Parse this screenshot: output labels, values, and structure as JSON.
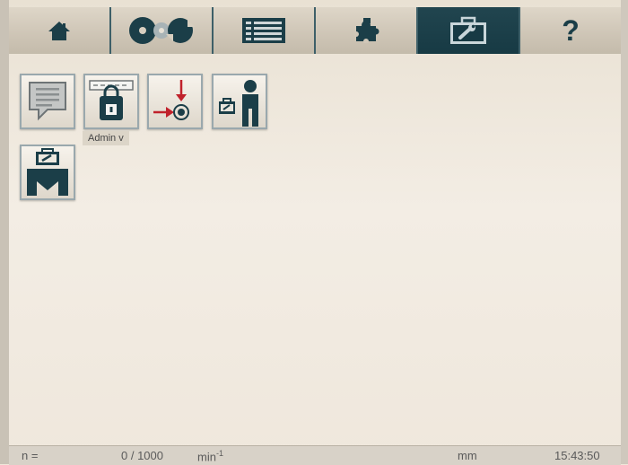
{
  "tabs": [
    {
      "name": "home-icon",
      "active": false
    },
    {
      "name": "reels-icon",
      "active": false
    },
    {
      "name": "list-icon",
      "active": false
    },
    {
      "name": "puzzle-icon",
      "active": false
    },
    {
      "name": "toolbox-icon",
      "active": true
    },
    {
      "name": "help-icon",
      "label": "?",
      "active": false
    }
  ],
  "tiles": [
    {
      "name": "messages-icon"
    },
    {
      "name": "lock-icon"
    },
    {
      "name": "reference-point-icon"
    },
    {
      "name": "service-person-icon"
    },
    {
      "name": "machine-service-icon"
    }
  ],
  "tooltip": {
    "text": "Admin v"
  },
  "status": {
    "n_label": "n =",
    "speed_value": "0 / 1000",
    "speed_unit": "min",
    "speed_unit_exp": "-1",
    "length_unit": "mm",
    "time": "15:43:50"
  },
  "colors": {
    "accent": "#173a44",
    "icon_dark": "#1b3e48",
    "marker_red": "#c0212b"
  }
}
